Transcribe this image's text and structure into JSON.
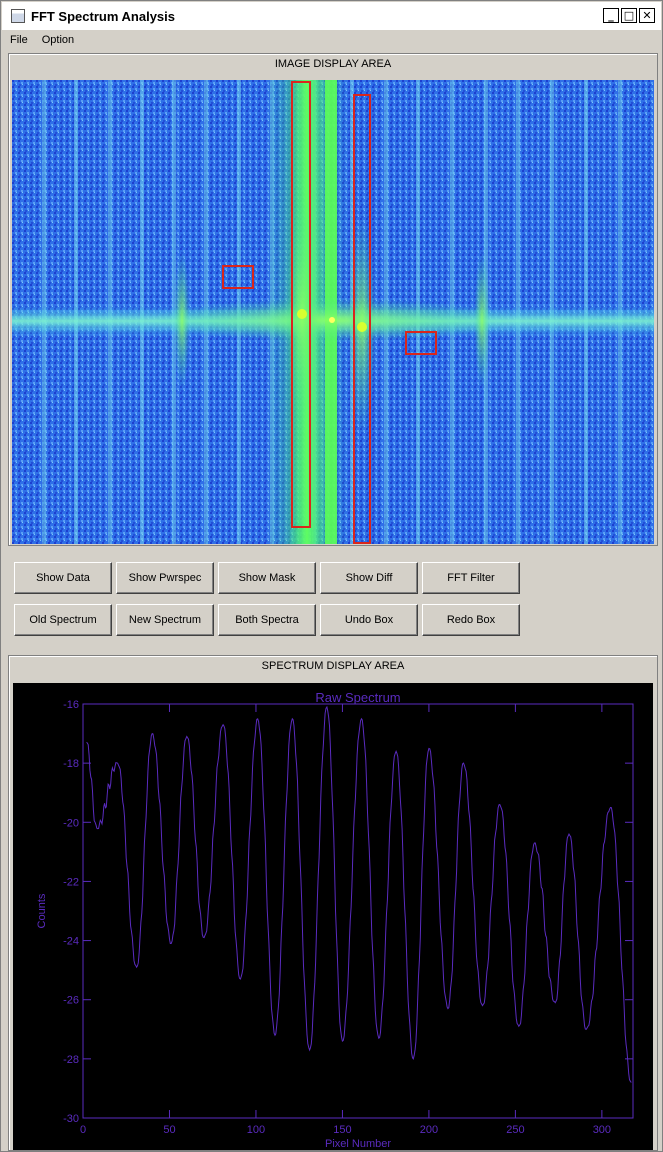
{
  "window": {
    "title": "FFT Spectrum Analysis",
    "controls": [
      "_",
      "□",
      "✕"
    ]
  },
  "menu": {
    "items": [
      "File",
      "Option"
    ]
  },
  "image_panel": {
    "title": "IMAGE DISPLAY AREA"
  },
  "buttons": {
    "row1": [
      "Show Data",
      "Show Pwrspec",
      "Show Mask",
      "Show Diff",
      "FFT Filter"
    ],
    "row2": [
      "Old Spectrum",
      "New Spectrum",
      "Both Spectra",
      "Undo Box",
      "Redo Box"
    ]
  },
  "spectrum_panel": {
    "title": "SPECTRUM DISPLAY AREA"
  },
  "colors": {
    "plot": "#5a2bbf",
    "selection_box": "#d9261c",
    "background": "#d4d0c8"
  },
  "chart_data": {
    "type": "line",
    "title": "Raw Spectrum",
    "xlabel": "Pixel Number",
    "ylabel": "Counts",
    "xlim": [
      0,
      318
    ],
    "ylim": [
      -30,
      -16
    ],
    "xticks": [
      0,
      50,
      100,
      150,
      200,
      250,
      300
    ],
    "yticks": [
      -16,
      -18,
      -20,
      -22,
      -24,
      -26,
      -28,
      -30
    ],
    "peaks": [
      [
        2,
        -17.3
      ],
      [
        20,
        -18.0
      ],
      [
        40,
        -17.0
      ],
      [
        60,
        -17.1
      ],
      [
        81,
        -16.7
      ],
      [
        101,
        -16.5
      ],
      [
        121,
        -16.5
      ],
      [
        141,
        -16.1
      ],
      [
        161,
        -16.5
      ],
      [
        181,
        -17.6
      ],
      [
        200,
        -17.5
      ],
      [
        220,
        -18.0
      ],
      [
        241,
        -19.4
      ],
      [
        261,
        -20.7
      ],
      [
        281,
        -20.4
      ],
      [
        305,
        -19.5
      ]
    ],
    "troughs": [
      [
        8,
        -20.2
      ],
      [
        31,
        -24.9
      ],
      [
        51,
        -24.1
      ],
      [
        70,
        -23.9
      ],
      [
        91,
        -25.3
      ],
      [
        111,
        -27.2
      ],
      [
        131,
        -27.7
      ],
      [
        150,
        -27.4
      ],
      [
        171,
        -27.3
      ],
      [
        191,
        -28.0
      ],
      [
        211,
        -26.3
      ],
      [
        231,
        -26.2
      ],
      [
        252,
        -26.9
      ],
      [
        273,
        -26.1
      ],
      [
        291,
        -27.0
      ],
      [
        317,
        -28.8
      ]
    ]
  }
}
